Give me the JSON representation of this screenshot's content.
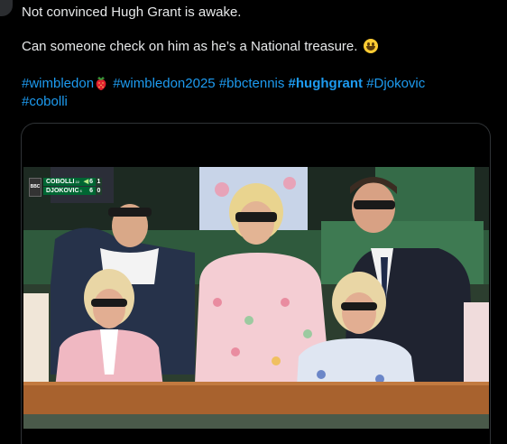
{
  "tweet": {
    "line1": "Not convinced Hugh Grant is awake.",
    "line2": "Can someone check on him as he’s a National treasure.",
    "smile_icon": "grinning-face-emoji",
    "hashtags": {
      "wimbledon": "#wimbledon",
      "strawberry_icon": "strawberry-emoji",
      "wimbledon2025": "#wimbledon2025",
      "bbctennis": "#bbctennis",
      "hughgrant": "#hughgrant",
      "djokovic": "#Djokovic",
      "cobolli": "#cobolli"
    },
    "link_color": "#1d9bf0"
  },
  "media": {
    "scoreboard": {
      "broadcaster": "BBC",
      "player1": {
        "name": "COBOLLI",
        "seed": "22",
        "sets": "6",
        "game": "1",
        "serving": true
      },
      "player2": {
        "name": "DJOKOVIC",
        "seed": "6",
        "sets": "6",
        "game": "0",
        "serving": false
      }
    },
    "accent_green": "#006633"
  }
}
